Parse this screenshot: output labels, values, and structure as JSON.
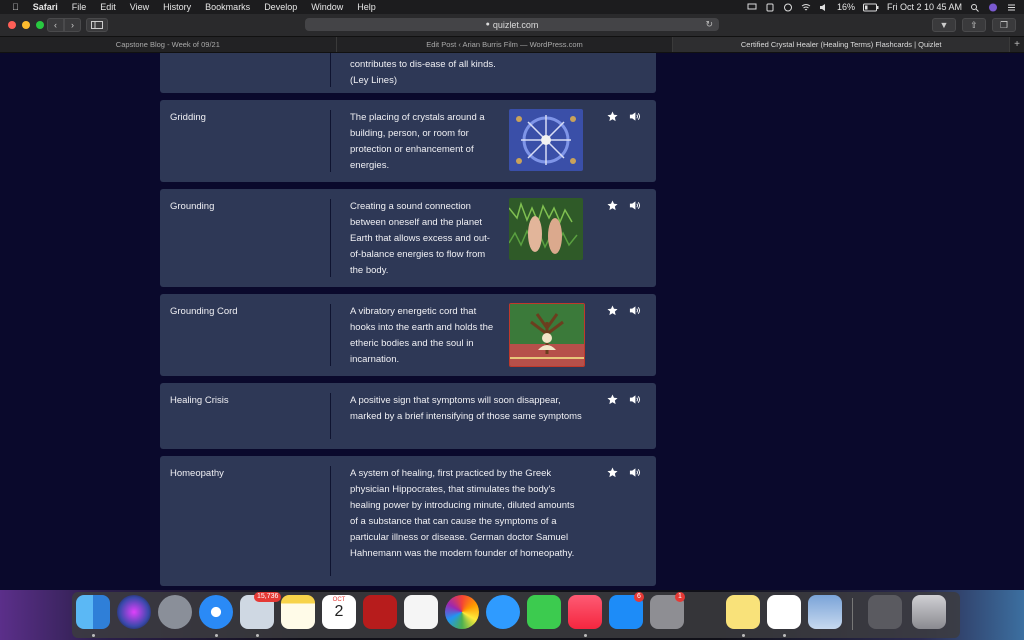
{
  "menubar": {
    "app": "Safari",
    "items": [
      "File",
      "Edit",
      "View",
      "History",
      "Bookmarks",
      "Develop",
      "Window",
      "Help"
    ],
    "battery": "16%",
    "clock": "Fri Oct 2  10 45 AM"
  },
  "browser": {
    "url": "quizlet.com",
    "tabs": [
      {
        "label": "Capstone Blog - Week of 09/21",
        "active": false
      },
      {
        "label": "Edit Post ‹ Arian Burris Film — WordPress.com",
        "active": false
      },
      {
        "label": "Certified Crystal Healer (Healing Terms) Flashcards | Quizlet",
        "active": true
      }
    ]
  },
  "cards": [
    {
      "term": "",
      "definition": "contributes to dis-ease of all kinds. (Ley Lines)",
      "image": "none"
    },
    {
      "term": "Gridding",
      "definition": "The placing of crystals around a building, person, or room for protection or enhancement of energies.",
      "image": "crystal-grid"
    },
    {
      "term": "Grounding",
      "definition": "Creating a sound connection between oneself and the planet Earth that allows excess and out-of-balance energies to flow from the body.",
      "image": "feet-in-grass"
    },
    {
      "term": "Grounding Cord",
      "definition": "A vibratory energetic cord that hooks into the earth and holds the etheric bodies and the soul in incarnation.",
      "image": "meditating-tree"
    },
    {
      "term": "Healing Crisis",
      "definition": "A positive sign that symptoms will soon disappear, marked by a brief intensifying of those same symptoms",
      "image": "none"
    },
    {
      "term": "Homeopathy",
      "definition": "A system of healing, first practiced by the Greek physician Hippocrates, that stimulates the body's healing power by introducing minute, diluted amounts of a substance that can cause the symptoms of a particular illness or disease. German doctor Samuel Hahnemann was the modern founder of homeopathy.",
      "image": "none"
    }
  ],
  "dock": {
    "mail_badge": "15,736",
    "calendar_month": "OCT",
    "calendar_day": "2",
    "appstore_badge": "6",
    "prefs_badge": "1"
  },
  "colors": {
    "page_bg": "#0a092c",
    "card_bg": "#2e3856"
  }
}
